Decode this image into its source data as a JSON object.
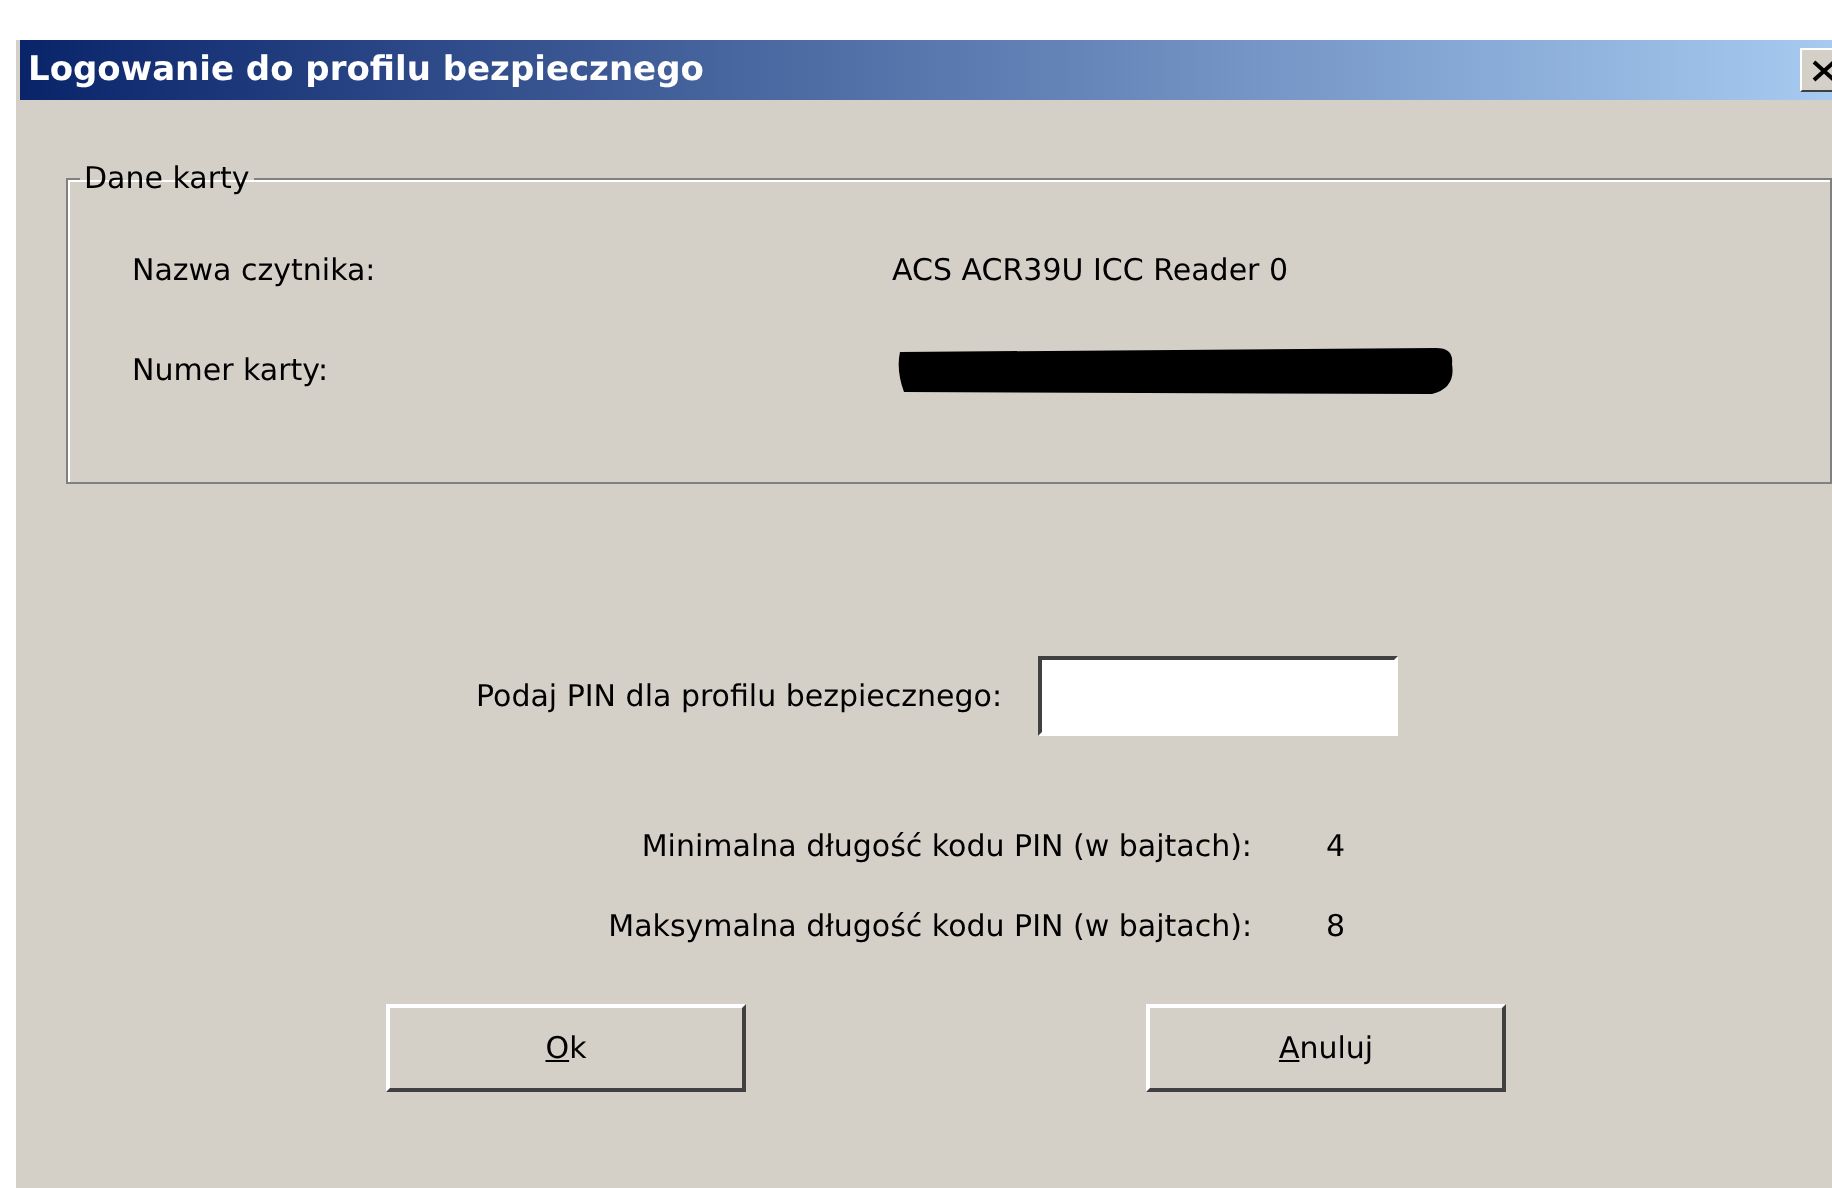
{
  "window": {
    "title": "Logowanie do profilu bezpiecznego"
  },
  "card_group": {
    "title": "Dane karty",
    "rows": [
      {
        "label": "Nazwa czytnika:",
        "kind": "text",
        "value": "ACS ACR39U ICC Reader 0"
      },
      {
        "label": "Numer karty:",
        "kind": "redacted"
      }
    ]
  },
  "pin": {
    "label": "Podaj PIN dla profilu bezpiecznego:"
  },
  "limits": [
    {
      "label": "Minimalna długość kodu PIN (w bajtach):",
      "value": "4"
    },
    {
      "label": "Maksymalna długość kodu PIN (w bajtach):",
      "value": "8"
    }
  ],
  "buttons": [
    {
      "label": "Ok",
      "access_key_underlined": true
    },
    {
      "label": "Anuluj",
      "access_key_underlined": true
    }
  ]
}
